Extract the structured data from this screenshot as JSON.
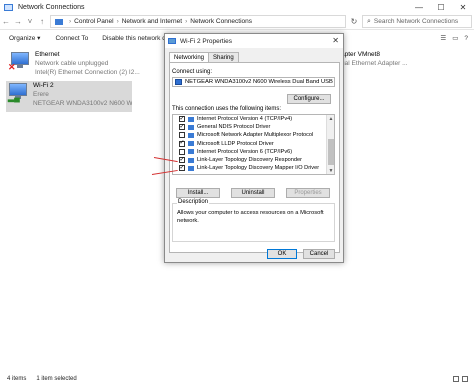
{
  "window": {
    "title": "Network Connections",
    "minimize": "—",
    "maximize": "☐",
    "close": "✕"
  },
  "address": {
    "crumbs": [
      "Control Panel",
      "Network and Internet",
      "Network Connections"
    ],
    "search_placeholder": "Search Network Connections"
  },
  "commands": {
    "organize": "Organize ▾",
    "connect": "Connect To",
    "disable": "Disable this network device"
  },
  "items": [
    {
      "name": "Ethernet",
      "status": "Network cable unplugged",
      "device": "Intel(R) Ethernet Connection (2) I2..."
    },
    {
      "name": "Wi-Fi 2",
      "status": "Erere",
      "device": "NETGEAR WNDA3100v2 N600 Wireless..."
    },
    {
      "name_partial": "apter VMnet8",
      "device_partial": "ual Ethernet Adapter ..."
    }
  ],
  "dialog": {
    "title": "Wi-Fi 2 Properties",
    "tabs": [
      "Networking",
      "Sharing"
    ],
    "connect_using_label": "Connect using:",
    "adapter": "NETGEAR WNDA3100v2 N600 Wireless Dual Band USB",
    "configure_label": "Configure...",
    "uses_label": "This connection uses the following items:",
    "components": [
      {
        "label": "Internet Protocol Version 4 (TCP/IPv4)",
        "checked": true,
        "kind": "net"
      },
      {
        "label": "General NDIS Protocol Driver",
        "checked": true,
        "kind": "net"
      },
      {
        "label": "Microsoft Network Adapter Multiplexor Protocol",
        "checked": false,
        "kind": "net"
      },
      {
        "label": "Microsoft LLDP Protocol Driver",
        "checked": true,
        "kind": "net"
      },
      {
        "label": "Internet Protocol Version 6 (TCP/IPv6)",
        "checked": false,
        "kind": "net"
      },
      {
        "label": "Link-Layer Topology Discovery Responder",
        "checked": true,
        "kind": "net"
      },
      {
        "label": "Link-Layer Topology Discovery Mapper I/O Driver",
        "checked": true,
        "kind": "net"
      }
    ],
    "install_label": "Install...",
    "uninstall_label": "Uninstall",
    "properties_label": "Properties",
    "description_label": "Description",
    "description_text": "Allows your computer to access resources on a Microsoft network.",
    "ok_label": "OK",
    "cancel_label": "Cancel"
  },
  "status": {
    "items_count": "4 items",
    "selected": "1 item selected"
  },
  "colors": {
    "arrow": "#d32f2f",
    "selection": "#cde8ff"
  }
}
